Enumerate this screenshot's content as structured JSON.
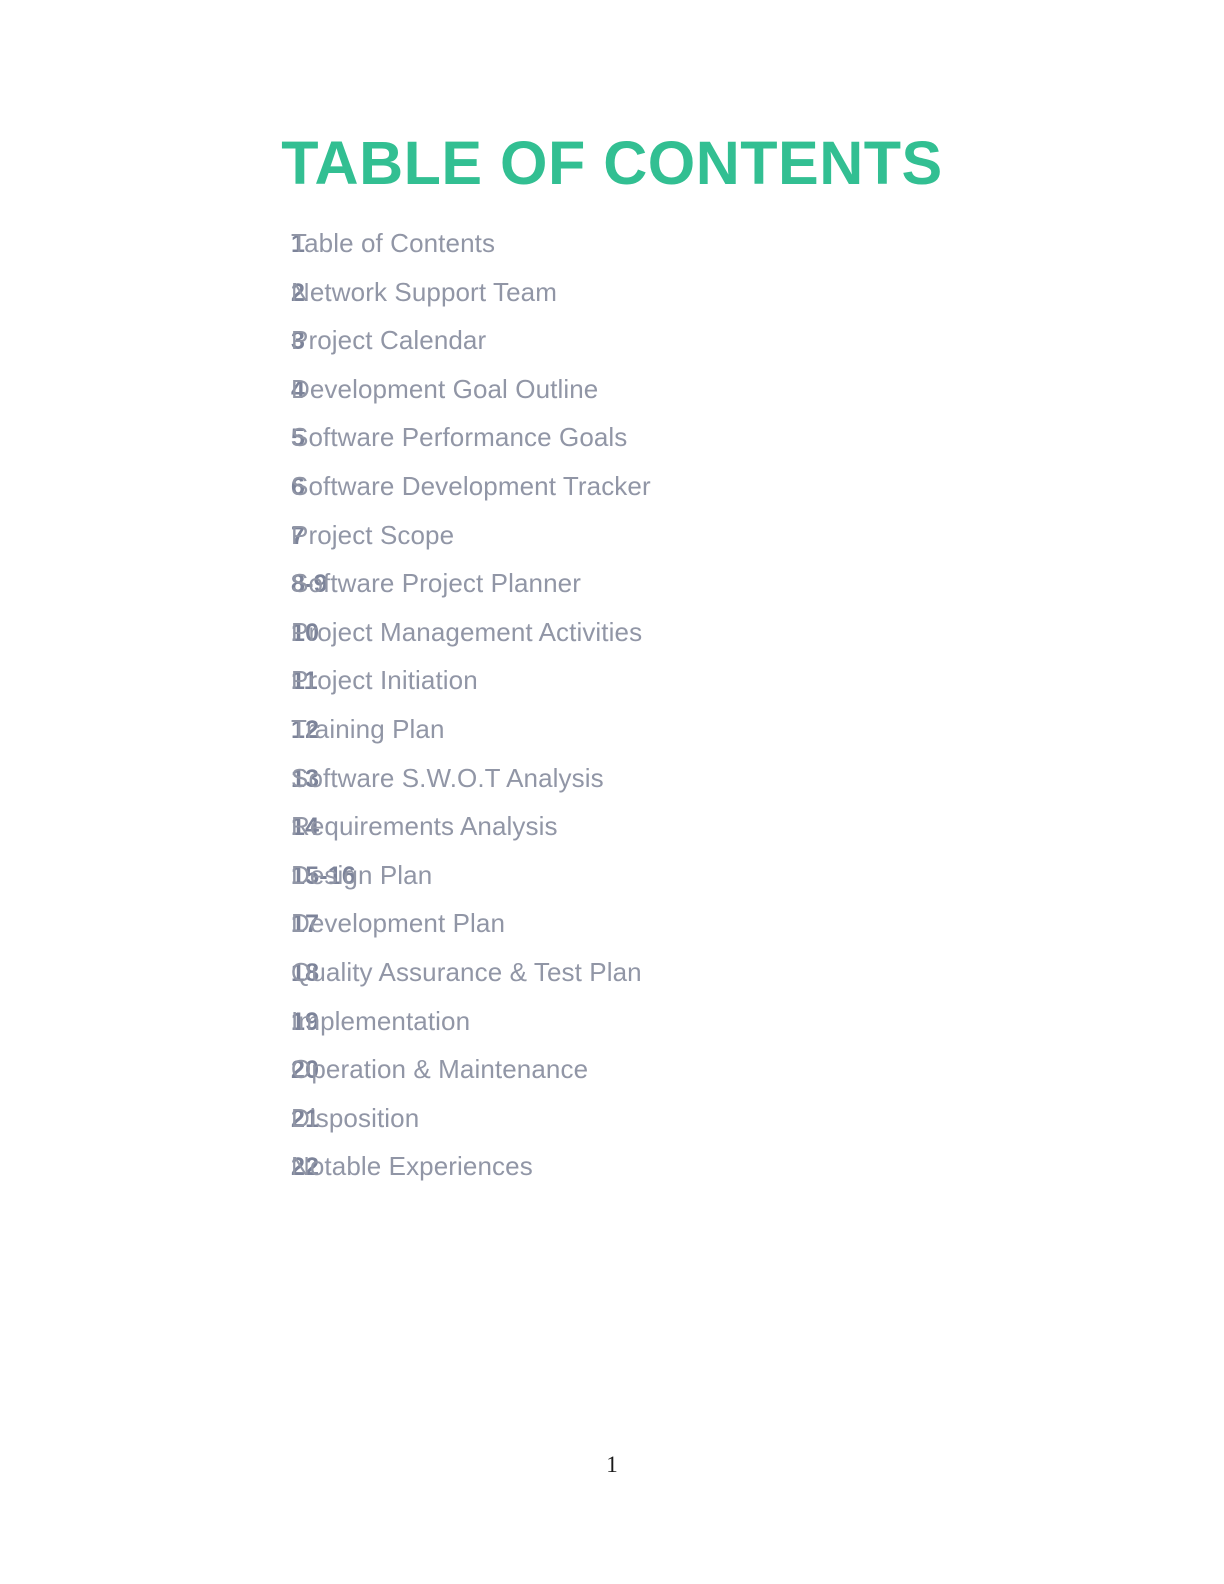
{
  "document": {
    "title": "TABLE OF CONTENTS",
    "title_color": "#32BF92",
    "number_color": "#7C8399",
    "label_color": "#9196A6",
    "background_color": "#FFFFFF",
    "footer_page_number": "1"
  },
  "toc": {
    "entries": [
      {
        "pages": "1",
        "label": "Table of Contents"
      },
      {
        "pages": "2",
        "label": "Network Support Team"
      },
      {
        "pages": "3",
        "label": "Project Calendar"
      },
      {
        "pages": "4",
        "label": "Development Goal Outline"
      },
      {
        "pages": "5",
        "label": "Software Performance Goals"
      },
      {
        "pages": "6",
        "label": "Software Development Tracker"
      },
      {
        "pages": "7",
        "label": "Project Scope"
      },
      {
        "pages": "8-9",
        "label": "Software Project Planner"
      },
      {
        "pages": "10",
        "label": "Project Management Activities"
      },
      {
        "pages": "11",
        "label": "Project Initiation"
      },
      {
        "pages": "12",
        "label": "Training Plan"
      },
      {
        "pages": "13",
        "label": "Software S.W.O.T Analysis"
      },
      {
        "pages": "14",
        "label": "Requirements Analysis"
      },
      {
        "pages": "15-16",
        "label": "Design Plan"
      },
      {
        "pages": "17",
        "label": "Development Plan"
      },
      {
        "pages": "18",
        "label": "Quality Assurance & Test Plan"
      },
      {
        "pages": "19",
        "label": "Implementation"
      },
      {
        "pages": "20",
        "label": "Operation & Maintenance"
      },
      {
        "pages": "21",
        "label": "Disposition"
      },
      {
        "pages": "22",
        "label": "Notable Experiences"
      }
    ]
  }
}
